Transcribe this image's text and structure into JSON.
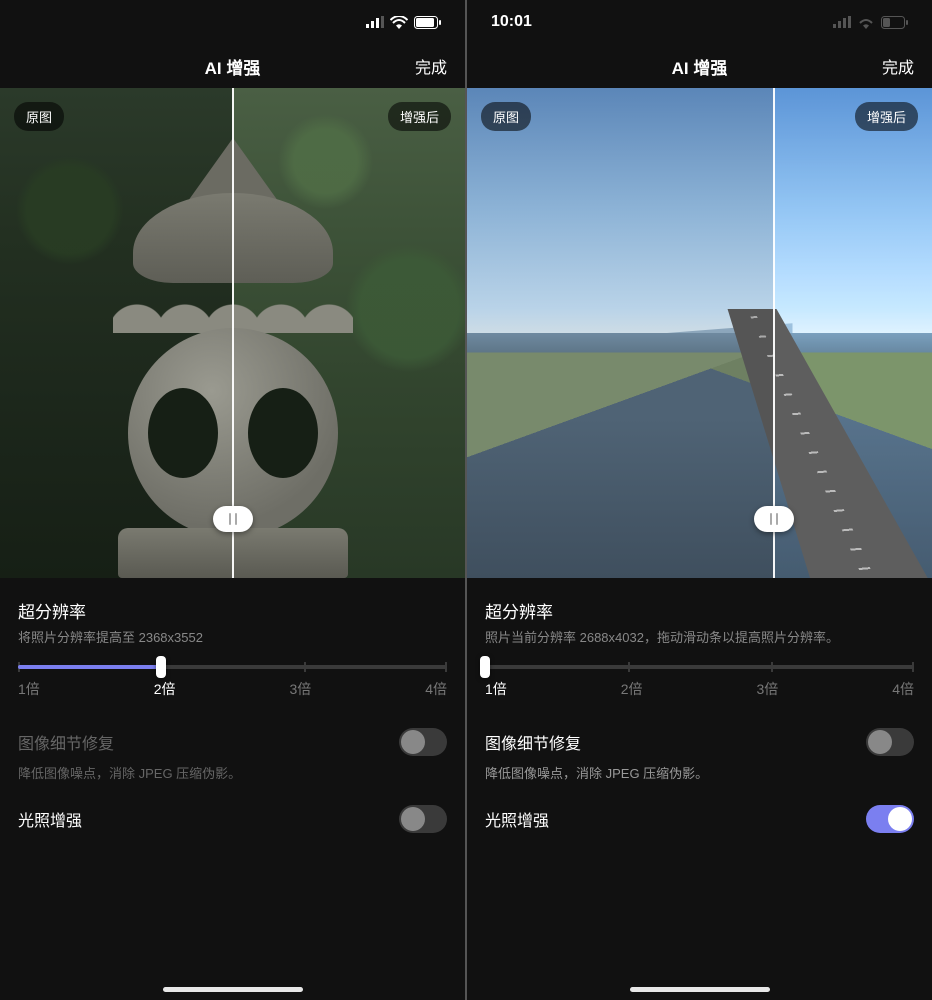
{
  "accent": "#7b7ff0",
  "screens": [
    {
      "status": {
        "time": "",
        "show_time": false
      },
      "nav": {
        "title": "AI 增强",
        "done": "完成"
      },
      "preview": {
        "badge_original": "原图",
        "badge_enhanced": "增强后",
        "split_percent": 50
      },
      "super_res": {
        "title": "超分辨率",
        "subtitle": "将照片分辨率提高至 2368x3552",
        "options": [
          "1倍",
          "2倍",
          "3倍",
          "4倍"
        ],
        "selected_index": 1,
        "fill_percent": 33
      },
      "detail_repair": {
        "title": "图像细节修复",
        "subtitle": "降低图像噪点，消除 JPEG 压缩伪影。",
        "enabled": false,
        "dim": true
      },
      "light_enhance": {
        "title": "光照增强",
        "enabled": false
      }
    },
    {
      "status": {
        "time": "10:01",
        "show_time": true
      },
      "nav": {
        "title": "AI 增强",
        "done": "完成"
      },
      "preview": {
        "badge_original": "原图",
        "badge_enhanced": "增强后",
        "split_percent": 66
      },
      "super_res": {
        "title": "超分辨率",
        "subtitle": "照片当前分辨率 2688x4032，拖动滑动条以提高照片分辨率。",
        "options": [
          "1倍",
          "2倍",
          "3倍",
          "4倍"
        ],
        "selected_index": 0,
        "fill_percent": 0
      },
      "detail_repair": {
        "title": "图像细节修复",
        "subtitle": "降低图像噪点，消除 JPEG 压缩伪影。",
        "enabled": false,
        "dim": false
      },
      "light_enhance": {
        "title": "光照增强",
        "enabled": true
      }
    }
  ]
}
